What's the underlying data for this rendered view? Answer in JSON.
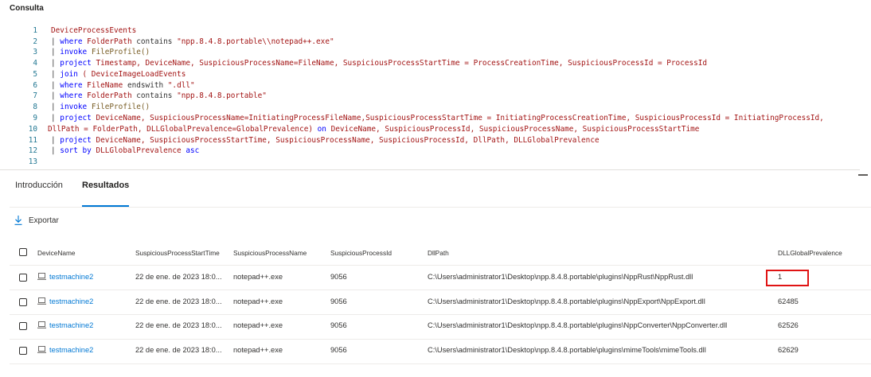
{
  "page": {
    "title": "Consulta"
  },
  "query": {
    "lines": [
      {
        "n": "1",
        "parts": [
          {
            "t": "DeviceProcessEvents",
            "c": "tbl"
          }
        ]
      },
      {
        "n": "2",
        "parts": [
          {
            "t": "| ",
            "c": "pipe"
          },
          {
            "t": "where",
            "c": "k"
          },
          {
            "t": " FolderPath ",
            "c": "f"
          },
          {
            "t": "contains",
            "c": "pipe"
          },
          {
            "t": " \"npp.8.4.8.portable\\\\notepad++.exe\"",
            "c": "s"
          }
        ]
      },
      {
        "n": "3",
        "parts": [
          {
            "t": "| ",
            "c": "pipe"
          },
          {
            "t": "invoke",
            "c": "k"
          },
          {
            "t": " FileProfile()",
            "c": "fn"
          }
        ]
      },
      {
        "n": "4",
        "parts": [
          {
            "t": "| ",
            "c": "pipe"
          },
          {
            "t": "project",
            "c": "k"
          },
          {
            "t": " Timestamp, DeviceName, SuspiciousProcessName=FileName, SuspiciousProcessStartTime = ProcessCreationTime, SuspiciousProcessId = ProcessId",
            "c": "f"
          }
        ]
      },
      {
        "n": "5",
        "parts": [
          {
            "t": "| ",
            "c": "pipe"
          },
          {
            "t": "join",
            "c": "k"
          },
          {
            "t": " ( DeviceImageLoadEvents",
            "c": "f"
          }
        ]
      },
      {
        "n": "6",
        "parts": [
          {
            "t": "| ",
            "c": "pipe"
          },
          {
            "t": "where",
            "c": "k"
          },
          {
            "t": " FileName ",
            "c": "f"
          },
          {
            "t": "endswith",
            "c": "pipe"
          },
          {
            "t": " \".dll\"",
            "c": "s"
          }
        ]
      },
      {
        "n": "7",
        "parts": [
          {
            "t": "| ",
            "c": "pipe"
          },
          {
            "t": "where",
            "c": "k"
          },
          {
            "t": " FolderPath ",
            "c": "f"
          },
          {
            "t": "contains",
            "c": "pipe"
          },
          {
            "t": " \"npp.8.4.8.portable\"",
            "c": "s"
          }
        ]
      },
      {
        "n": "8",
        "parts": [
          {
            "t": "| ",
            "c": "pipe"
          },
          {
            "t": "invoke",
            "c": "k"
          },
          {
            "t": " FileProfile()",
            "c": "fn"
          }
        ]
      },
      {
        "n": "9",
        "parts": [
          {
            "t": "| ",
            "c": "pipe"
          },
          {
            "t": "project",
            "c": "k"
          },
          {
            "t": " DeviceName, SuspiciousProcessName=InitiatingProcessFileName,SuspiciousProcessStartTime = InitiatingProcessCreationTime, SuspiciousProcessId = InitiatingProcessId,",
            "c": "f"
          }
        ]
      },
      {
        "n": "10",
        "parts": [
          {
            "t": "DllPath = FolderPath, DLLGlobalPrevalence=GlobalPrevalence) ",
            "c": "f"
          },
          {
            "t": "on",
            "c": "k"
          },
          {
            "t": " DeviceName, SuspiciousProcessId, SuspiciousProcessName, SuspiciousProcessStartTime",
            "c": "f"
          }
        ]
      },
      {
        "n": "11",
        "parts": [
          {
            "t": "| ",
            "c": "pipe"
          },
          {
            "t": "project",
            "c": "k"
          },
          {
            "t": " DeviceName, SuspiciousProcessStartTime, SuspiciousProcessName, SuspiciousProcessId, DllPath, DLLGlobalPrevalence",
            "c": "f"
          }
        ]
      },
      {
        "n": "12",
        "parts": [
          {
            "t": "| ",
            "c": "pipe"
          },
          {
            "t": "sort by",
            "c": "k"
          },
          {
            "t": " DLLGlobalPrevalence ",
            "c": "f"
          },
          {
            "t": "asc",
            "c": "k"
          }
        ]
      },
      {
        "n": "13",
        "parts": []
      }
    ]
  },
  "tabs": [
    {
      "label": "Introducción",
      "active": false
    },
    {
      "label": "Resultados",
      "active": true
    }
  ],
  "toolbar": {
    "export_label": "Exportar"
  },
  "table": {
    "columns": [
      "DeviceName",
      "SuspiciousProcessStartTime",
      "SuspiciousProcessName",
      "SuspiciousProcessId",
      "DllPath",
      "DLLGlobalPrevalence"
    ],
    "rows": [
      {
        "device": "testmachine2",
        "time": "22 de ene. de 2023 18:0...",
        "process": "notepad++.exe",
        "pid": "9056",
        "dll": "C:\\Users\\administrator1\\Desktop\\npp.8.4.8.portable\\plugins\\NppRust\\NppRust.dll",
        "prevalence": "1"
      },
      {
        "device": "testmachine2",
        "time": "22 de ene. de 2023 18:0...",
        "process": "notepad++.exe",
        "pid": "9056",
        "dll": "C:\\Users\\administrator1\\Desktop\\npp.8.4.8.portable\\plugins\\NppExport\\NppExport.dll",
        "prevalence": "62485"
      },
      {
        "device": "testmachine2",
        "time": "22 de ene. de 2023 18:0...",
        "process": "notepad++.exe",
        "pid": "9056",
        "dll": "C:\\Users\\administrator1\\Desktop\\npp.8.4.8.portable\\plugins\\NppConverter\\NppConverter.dll",
        "prevalence": "62526"
      },
      {
        "device": "testmachine2",
        "time": "22 de ene. de 2023 18:0...",
        "process": "notepad++.exe",
        "pid": "9056",
        "dll": "C:\\Users\\administrator1\\Desktop\\npp.8.4.8.portable\\plugins\\mimeTools\\mimeTools.dll",
        "prevalence": "62629"
      }
    ]
  },
  "colors": {
    "accent": "#0078d4",
    "highlight": "#e01313",
    "keyword": "#0000ff",
    "string": "#a31515",
    "line_number": "#237893"
  },
  "icons": {
    "export": "download-icon",
    "device": "laptop-icon"
  }
}
